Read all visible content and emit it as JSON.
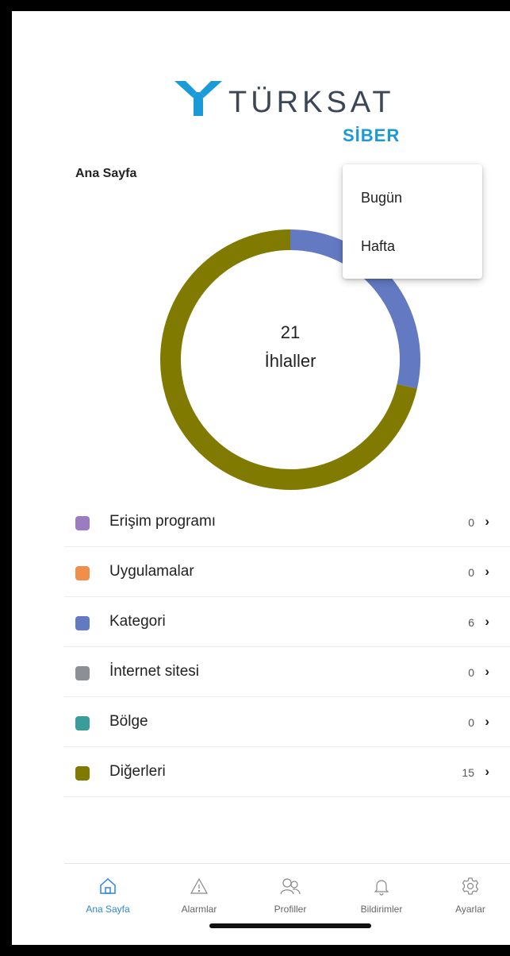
{
  "brand": {
    "name": "TÜRKSAT",
    "sub": "SİBER",
    "accent": "#1a9ad6"
  },
  "header": {
    "title": "Ana Sayfa"
  },
  "period_menu": {
    "items": [
      {
        "label": "Bugün"
      },
      {
        "label": "Hafta"
      }
    ]
  },
  "summary": {
    "count": "21",
    "label": "İhlaller"
  },
  "chart_data": {
    "type": "pie",
    "categories": [
      "Erişim programı",
      "Uygulamalar",
      "Kategori",
      "İnternet sitesi",
      "Bölge",
      "Diğerleri"
    ],
    "values": [
      0,
      0,
      6,
      0,
      0,
      15
    ],
    "colors": [
      "#9b7cc0",
      "#f08f4a",
      "#6379c1",
      "#8c9096",
      "#3a9d9b",
      "#807b00"
    ]
  },
  "categories": [
    {
      "label": "Erişim programı",
      "count": "0",
      "color": "#9b7cc0"
    },
    {
      "label": "Uygulamalar",
      "count": "0",
      "color": "#f08f4a"
    },
    {
      "label": "Kategori",
      "count": "6",
      "color": "#6379c1"
    },
    {
      "label": "İnternet sitesi",
      "count": "0",
      "color": "#8c9096"
    },
    {
      "label": "Bölge",
      "count": "0",
      "color": "#3a9d9b"
    },
    {
      "label": "Diğerleri",
      "count": "15",
      "color": "#807b00"
    }
  ],
  "tabs": [
    {
      "label": "Ana Sayfa",
      "icon": "home-icon",
      "active": true
    },
    {
      "label": "Alarmlar",
      "icon": "warning-icon",
      "active": false
    },
    {
      "label": "Profiller",
      "icon": "users-icon",
      "active": false
    },
    {
      "label": "Bildirimler",
      "icon": "bell-icon",
      "active": false
    },
    {
      "label": "Ayarlar",
      "icon": "gear-icon",
      "active": false
    }
  ]
}
